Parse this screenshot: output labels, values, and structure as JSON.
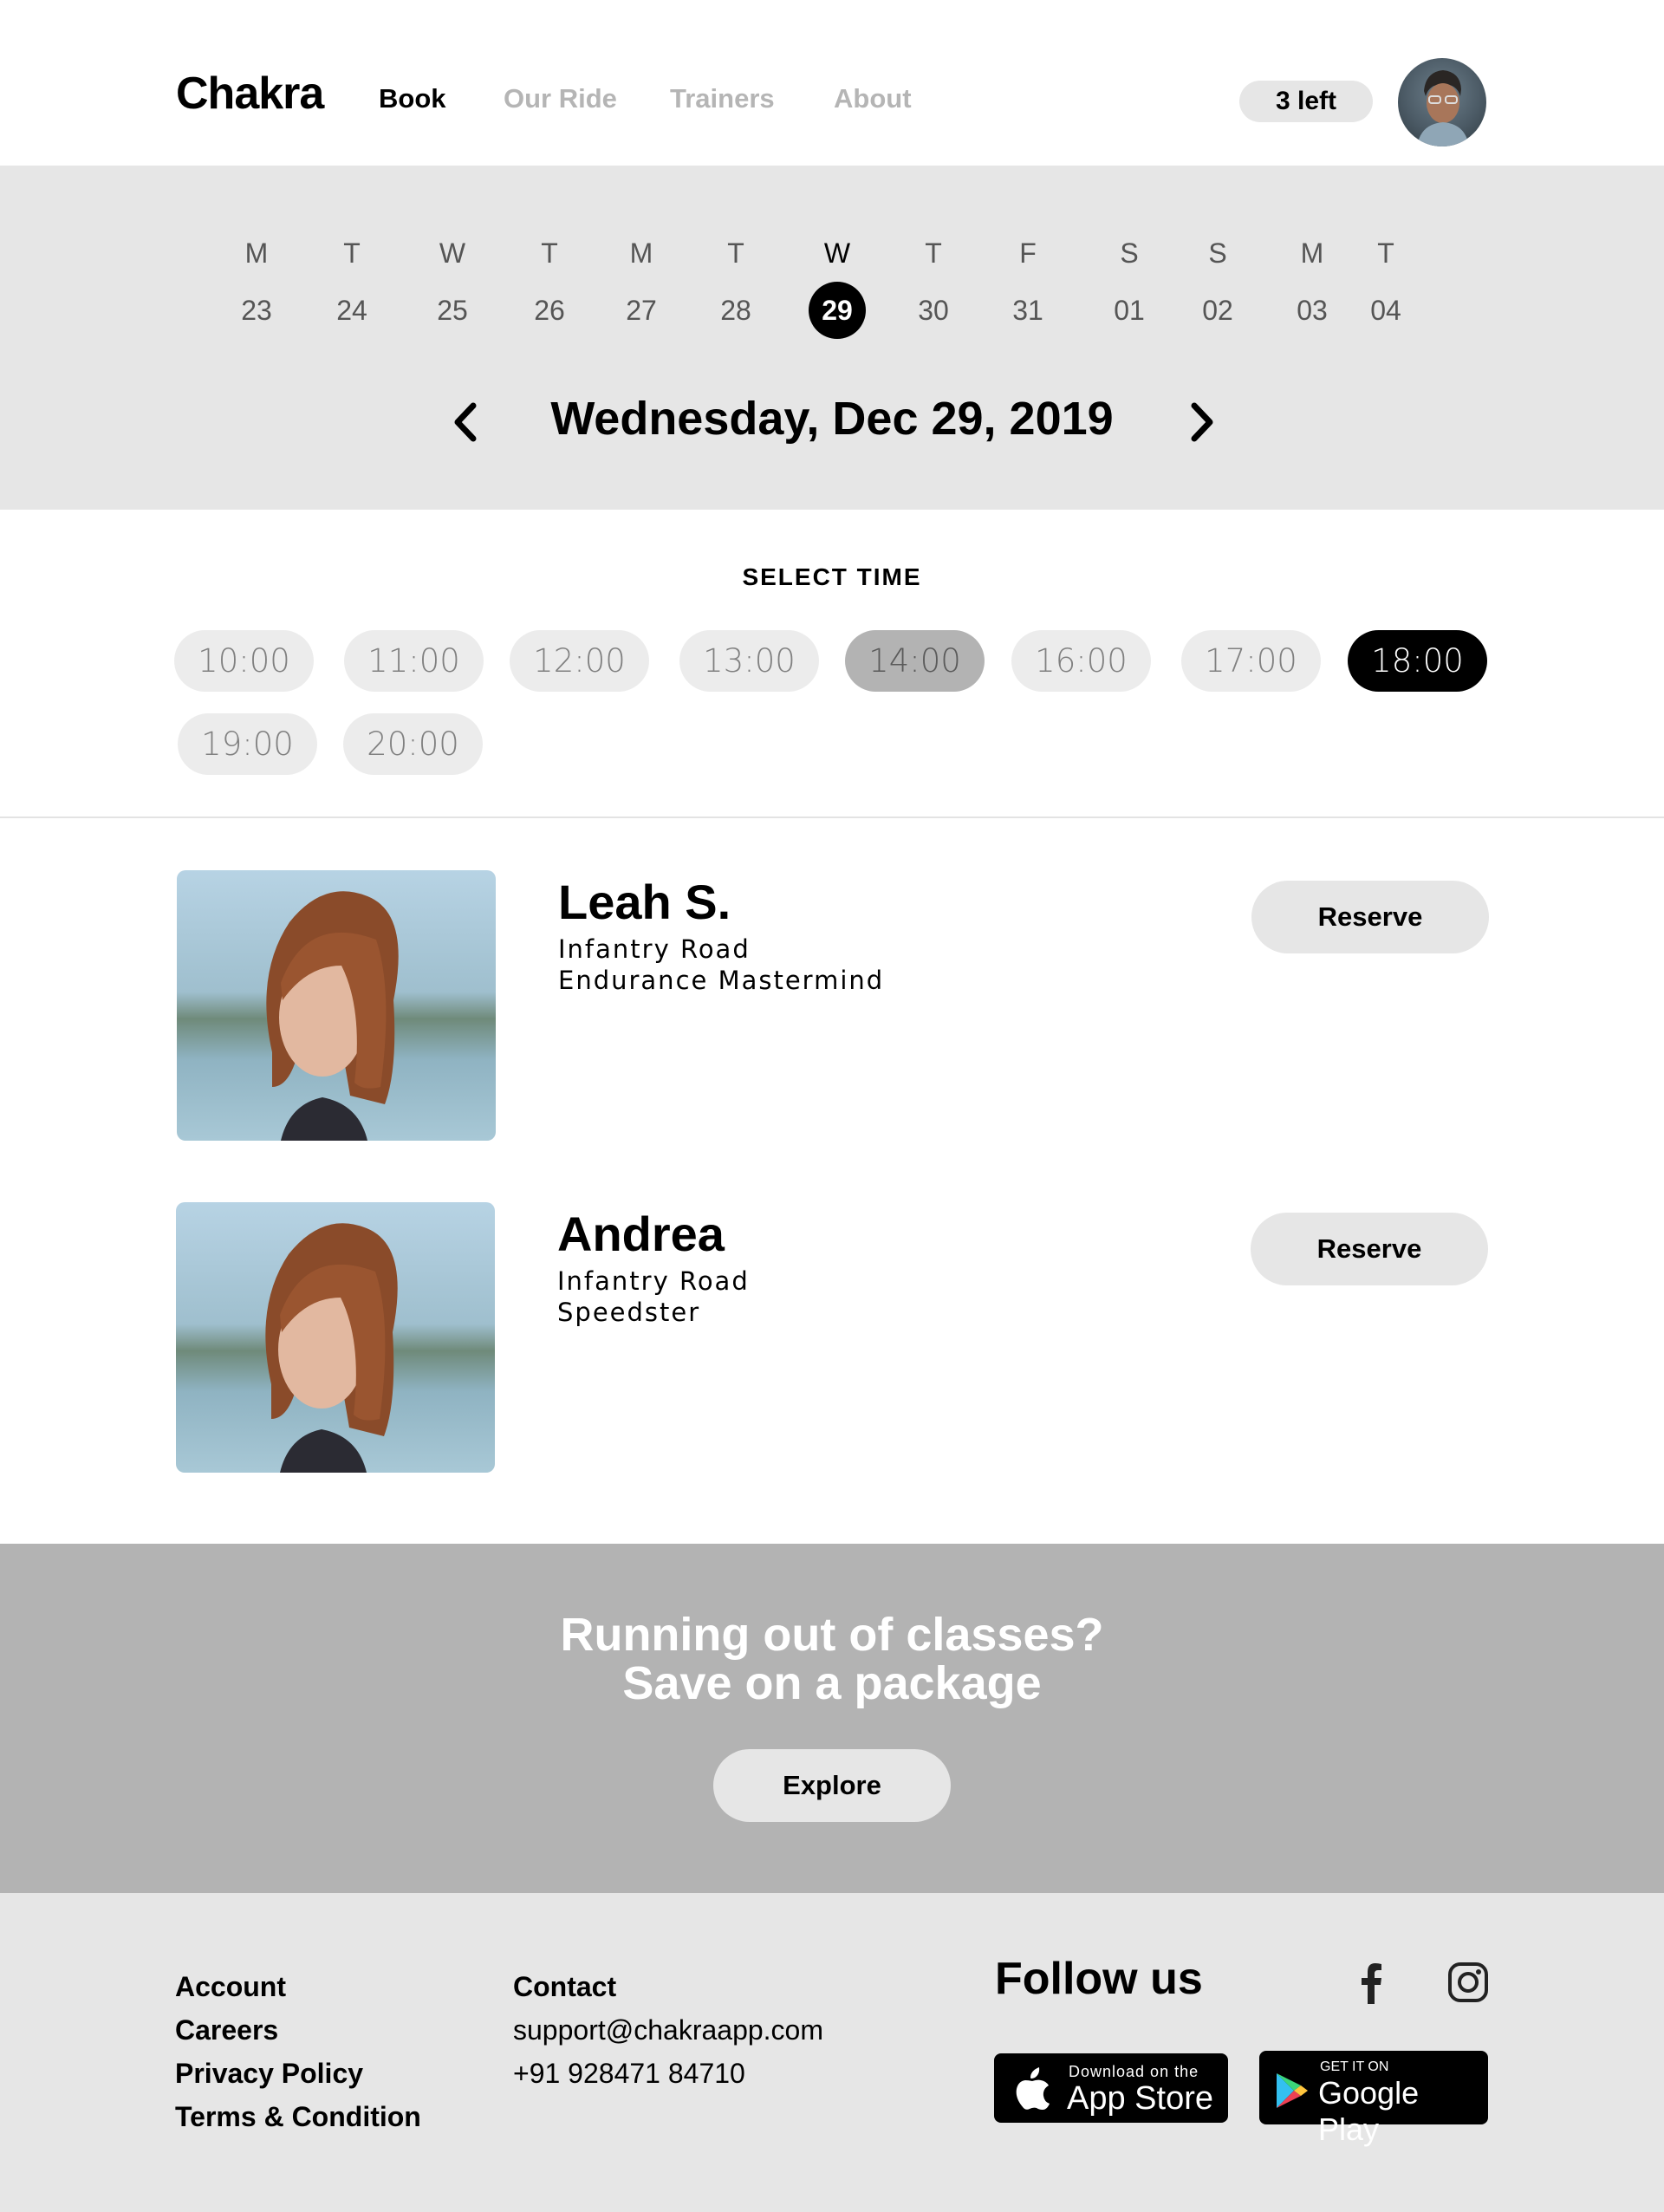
{
  "header": {
    "logo": "Chakra",
    "nav": [
      "Book",
      "Our Ride",
      "Trainers",
      "About"
    ],
    "credits": "3 left"
  },
  "calendar": {
    "days": [
      {
        "letter": "M",
        "num": "23"
      },
      {
        "letter": "T",
        "num": "24"
      },
      {
        "letter": "W",
        "num": "25"
      },
      {
        "letter": "T",
        "num": "26"
      },
      {
        "letter": "M",
        "num": "27"
      },
      {
        "letter": "T",
        "num": "28"
      },
      {
        "letter": "W",
        "num": "29"
      },
      {
        "letter": "T",
        "num": "30"
      },
      {
        "letter": "F",
        "num": "31"
      },
      {
        "letter": "S",
        "num": "01"
      },
      {
        "letter": "S",
        "num": "02"
      },
      {
        "letter": "M",
        "num": "03"
      },
      {
        "letter": "T",
        "num": "04"
      }
    ],
    "selected_date": "Wednesday, Dec 29, 2019"
  },
  "time": {
    "heading": "SELECT TIME",
    "slots": [
      "10:00",
      "11:00",
      "12:00",
      "13:00",
      "14:00",
      "16:00",
      "17:00",
      "18:00",
      "19:00",
      "20:00"
    ]
  },
  "trainers": [
    {
      "name": "Leah S.",
      "location": "Infantry Road",
      "title": "Endurance Mastermind",
      "button": "Reserve"
    },
    {
      "name": "Andrea",
      "location": "Infantry Road",
      "title": "Speedster",
      "button": "Reserve"
    }
  ],
  "promo": {
    "line1": "Running out of classes?",
    "line2": "Save on a package",
    "button": "Explore"
  },
  "footer": {
    "links": [
      "Account",
      "Careers",
      "Privacy Policy",
      "Terms & Condition"
    ],
    "contact_heading": "Contact",
    "email": "support@chakraapp.com",
    "phone": "+91 928471 84710",
    "follow": "Follow us",
    "appstore_small": "Download on the",
    "appstore_big": "App Store",
    "googleplay_small": "GET IT ON",
    "googleplay_big": "Google Play"
  },
  "colors": {
    "band": "#e6e6e6",
    "promo": "#b3b3b3",
    "accent": "#000000"
  }
}
